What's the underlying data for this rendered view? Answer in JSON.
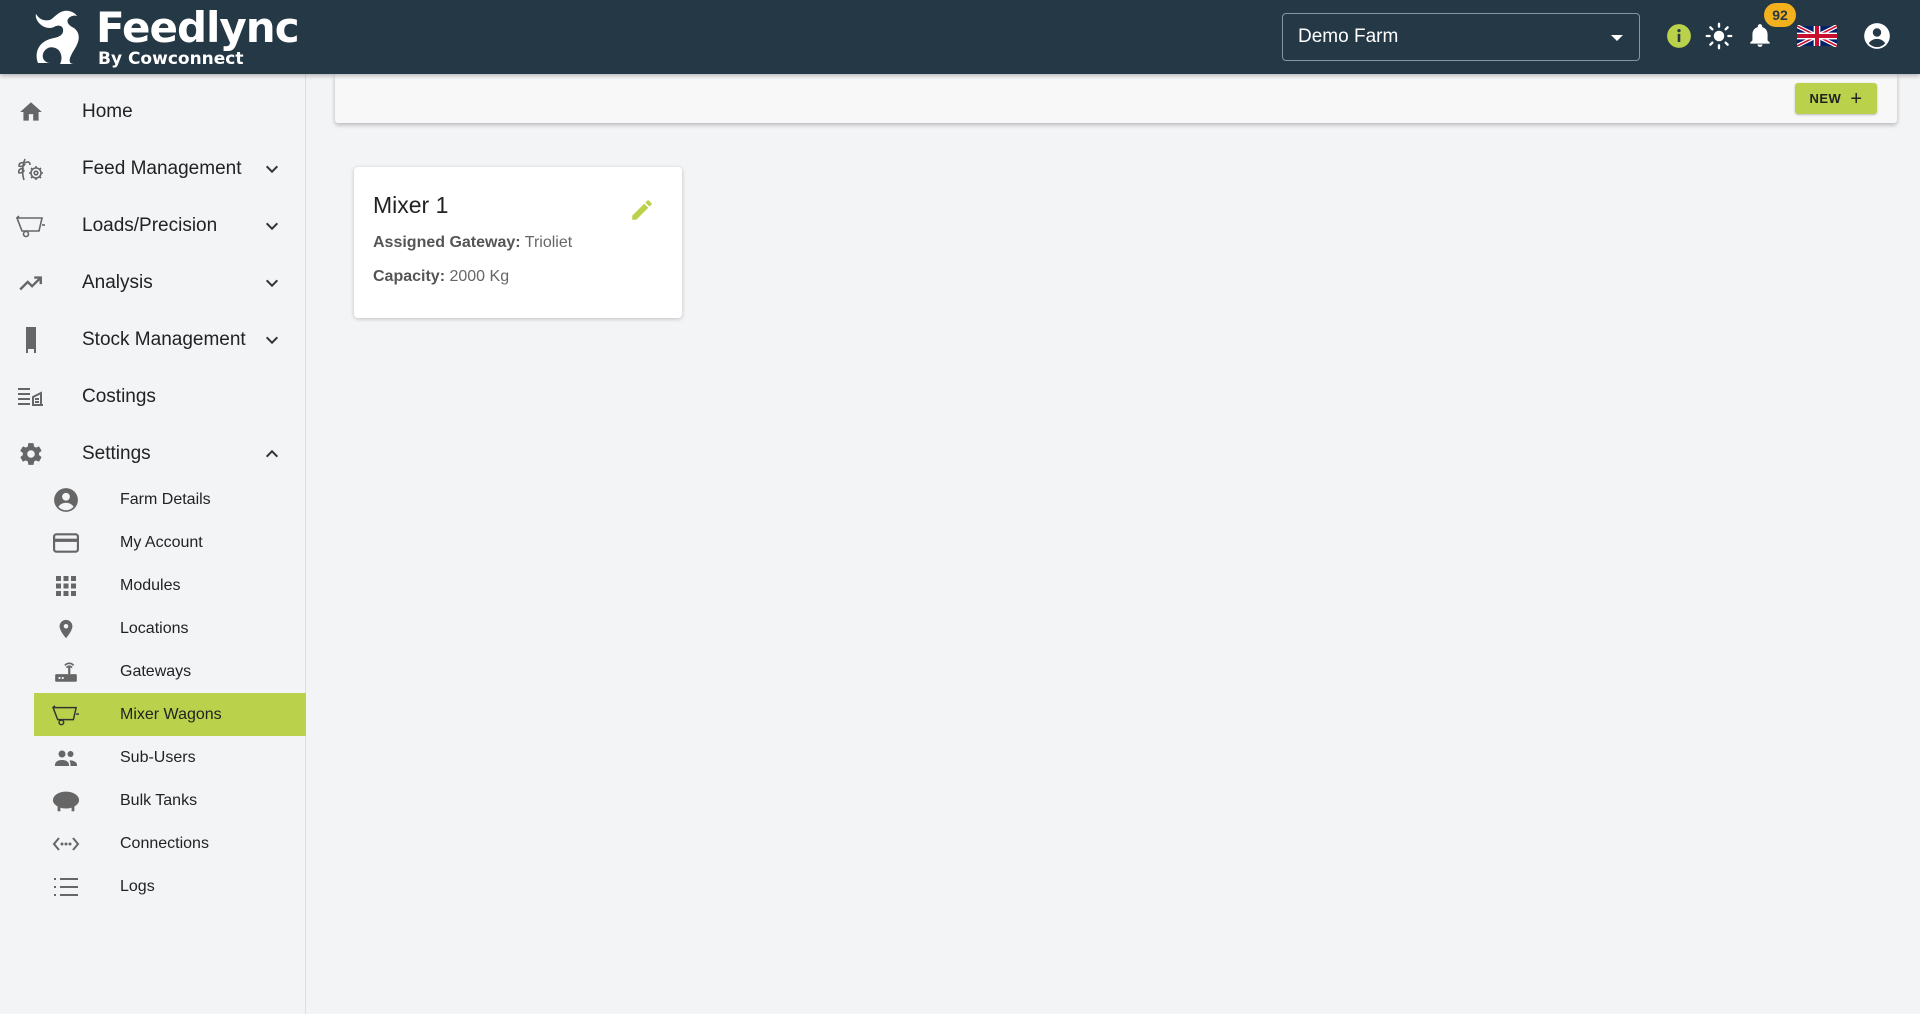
{
  "app": {
    "name": "Feedlync",
    "subtitle": "By Cowconnect"
  },
  "header": {
    "farm_selected": "Demo Farm",
    "notification_count": "92",
    "language": "English (UK)"
  },
  "sidebar": {
    "items": [
      {
        "label": "Home",
        "icon": "home-icon"
      },
      {
        "label": "Feed Management",
        "icon": "feed-management-icon",
        "expanded": false
      },
      {
        "label": "Loads/Precision",
        "icon": "mixer-wagon-icon",
        "expanded": false
      },
      {
        "label": "Analysis",
        "icon": "trending-up-icon",
        "expanded": false
      },
      {
        "label": "Stock Management",
        "icon": "silo-icon",
        "expanded": false
      },
      {
        "label": "Costings",
        "icon": "costings-icon"
      },
      {
        "label": "Settings",
        "icon": "gear-icon",
        "expanded": true
      }
    ],
    "settings_items": [
      {
        "label": "Farm Details",
        "icon": "account-circle-icon"
      },
      {
        "label": "My Account",
        "icon": "credit-card-icon"
      },
      {
        "label": "Modules",
        "icon": "grid-icon"
      },
      {
        "label": "Locations",
        "icon": "location-pin-icon"
      },
      {
        "label": "Gateways",
        "icon": "router-icon"
      },
      {
        "label": "Mixer Wagons",
        "icon": "mixer-wagon-icon",
        "active": true
      },
      {
        "label": "Sub-Users",
        "icon": "people-icon"
      },
      {
        "label": "Bulk Tanks",
        "icon": "tank-icon"
      },
      {
        "label": "Connections",
        "icon": "connection-icon"
      },
      {
        "label": "Logs",
        "icon": "list-icon"
      }
    ]
  },
  "toolbar": {
    "new_label": "NEW"
  },
  "mixers": [
    {
      "name": "Mixer 1",
      "gateway_label": "Assigned Gateway:",
      "gateway": "Trioliet",
      "capacity_label": "Capacity:",
      "capacity": "2000 Kg"
    }
  ],
  "colors": {
    "header_bg": "#243845",
    "accent": "#b9d14b",
    "badge": "#f2b11d",
    "background": "#f3f4f6"
  }
}
